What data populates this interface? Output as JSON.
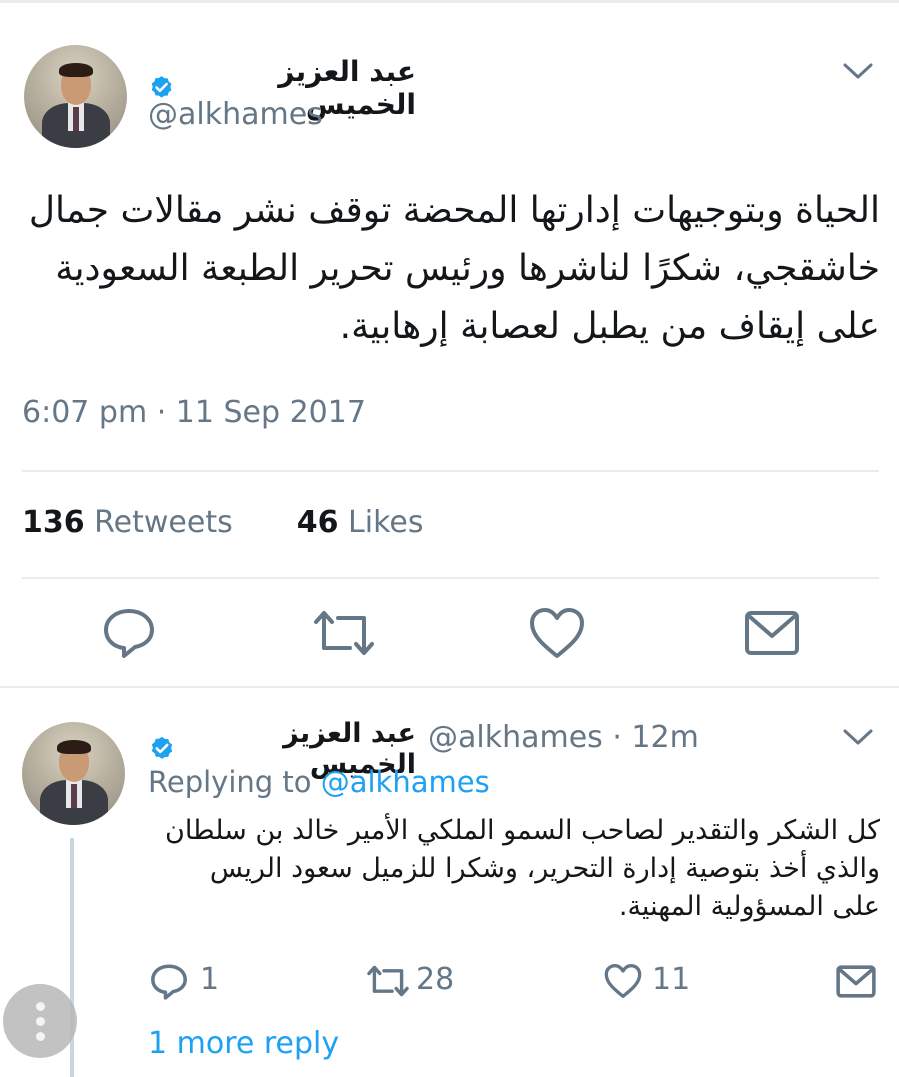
{
  "main_tweet": {
    "author_name": "عبد العزيز الخميس",
    "handle": "@alkhames",
    "text": "الحياة وبتوجيهات إدارتها المحضة توقف نشر مقالات جمال\nخاشقجي، شكرًا لناشرها ورئيس تحرير الطبعة السعودية\nعلى إيقاف من يطبل لعصابة إرهابية.",
    "timestamp": "6:07 pm · 11 Sep 2017",
    "retweets_count": "136",
    "retweets_label": "Retweets",
    "likes_count": "46",
    "likes_label": "Likes"
  },
  "reply": {
    "author_name": "عبد العزيز الخميس",
    "handle_time": "@alkhames · 12m",
    "replying_prefix": "Replying to",
    "replying_to": "@alkhames",
    "text": "كل الشكر والتقدير لصاحب السمو الملكي الأمير خالد بن سلطان\nوالذي أخذ بتوصية إدارة التحرير، وشكرا للزميل سعود الريس\nعلى المسؤولية المهنية.",
    "reply_count": "1",
    "retweet_count": "28",
    "like_count": "11",
    "more_replies": "1 more reply"
  },
  "icons": {
    "verified": "verified-badge-icon",
    "chevron": "chevron-down-icon",
    "reply": "reply-icon",
    "retweet": "retweet-icon",
    "like": "heart-icon",
    "dm": "envelope-icon",
    "more": "more-options-icon"
  },
  "colors": {
    "accent": "#1da1f2",
    "secondary_text": "#657786",
    "divider": "#e6ecf0"
  }
}
